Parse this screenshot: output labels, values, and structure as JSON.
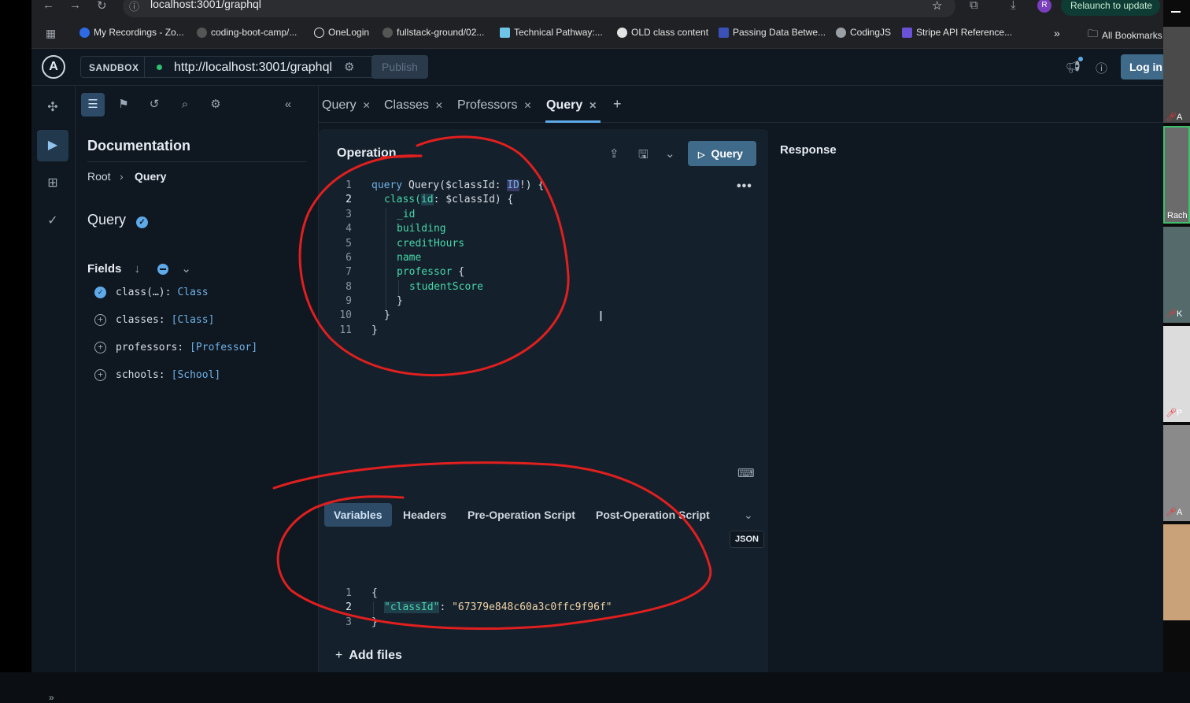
{
  "browser": {
    "url": "localhost:3001/graphql",
    "relaunch_label": "Relaunch to update",
    "profile_initial": "R",
    "bookmarks": [
      "My Recordings - Zo...",
      "coding-boot-camp/...",
      "OneLogin",
      "fullstack-ground/02...",
      "Technical Pathway:...",
      "OLD class content",
      "Passing Data Betwe...",
      "CodingJS",
      "Stripe API Reference..."
    ],
    "all_bookmarks": "All Bookmarks",
    "overflow": "»"
  },
  "header": {
    "sandbox_label": "SANDBOX",
    "endpoint": "http://localhost:3001/graphql",
    "publish_label": "Publish",
    "login_label": "Log in"
  },
  "docs": {
    "title": "Documentation",
    "breadcrumb_root": "Root",
    "breadcrumb_sep": "›",
    "breadcrumb_current": "Query",
    "type_name": "Query",
    "fields_heading": "Fields",
    "fields": [
      {
        "name": "class(…):",
        "type": "Class",
        "selected": true
      },
      {
        "name": "classes:",
        "type": "[Class]",
        "selected": false
      },
      {
        "name": "professors:",
        "type": "[Professor]",
        "selected": false
      },
      {
        "name": "schools:",
        "type": "[School]",
        "selected": false
      }
    ]
  },
  "tabs": [
    {
      "label": "Query",
      "active": false
    },
    {
      "label": "Classes",
      "active": false
    },
    {
      "label": "Professors",
      "active": false
    },
    {
      "label": "Query",
      "active": true
    }
  ],
  "operation": {
    "title": "Operation",
    "run_label": "Query",
    "line_numbers": [
      "1",
      "2",
      "3",
      "4",
      "5",
      "6",
      "7",
      "8",
      "9",
      "10",
      "11"
    ],
    "code": {
      "l1_kw": "query",
      "l1_name": " Query(",
      "l1_var": "$classId",
      "l1_colon": ": ",
      "l1_type": "ID",
      "l1_end": "!) {",
      "l2_field": "class(",
      "l2_arg": "id",
      "l2_colon": ": ",
      "l2_var": "$classId",
      "l2_end": ") {",
      "l3": "_id",
      "l4": "building",
      "l5": "creditHours",
      "l6": "name",
      "l7_field": "professor",
      "l7_end": " {",
      "l8": "studentScore",
      "l9": "}",
      "l10": "}",
      "l11": "}"
    }
  },
  "variables": {
    "tabs": [
      "Variables",
      "Headers",
      "Pre-Operation Script",
      "Post-Operation Script"
    ],
    "badge": "JSON",
    "line_numbers": [
      "1",
      "2",
      "3"
    ],
    "open": "{",
    "key": "\"classId\"",
    "colon": ": ",
    "value": "\"67379e848c60a3c0ffc9f96f\"",
    "close": "}",
    "add_files": "Add files"
  },
  "response": {
    "title": "Response"
  },
  "video": {
    "participants": [
      "A",
      "Rach",
      "K",
      "P",
      "A"
    ]
  },
  "colors": {
    "accent": "#5ea9e8",
    "field_green": "#48d7a9",
    "annotation_red": "#e01f1f",
    "button_blue": "#3f6a8a"
  }
}
